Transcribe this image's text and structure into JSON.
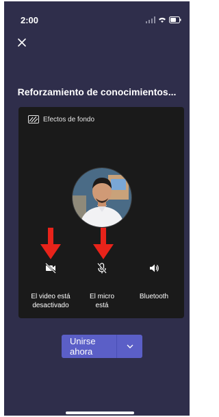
{
  "status_bar": {
    "time": "2:00"
  },
  "meeting": {
    "title": "Reforzamiento de conocimientos..."
  },
  "preview": {
    "background_effects_label": "Efectos de fondo"
  },
  "controls": [
    {
      "label_line1": "El video está",
      "label_line2": "desactivado",
      "icon": "video-off-icon"
    },
    {
      "label_line1": "El micro",
      "label_line2": "está",
      "icon": "mic-off-icon"
    },
    {
      "label_line1": "Bluetooth",
      "label_line2": "",
      "icon": "speaker-icon"
    }
  ],
  "join": {
    "label": "Unirse ahora"
  },
  "colors": {
    "background": "#2f2e4b",
    "card": "#1a1a1a",
    "accent": "#5b5fc7",
    "annotation_arrow": "#e8231a"
  }
}
